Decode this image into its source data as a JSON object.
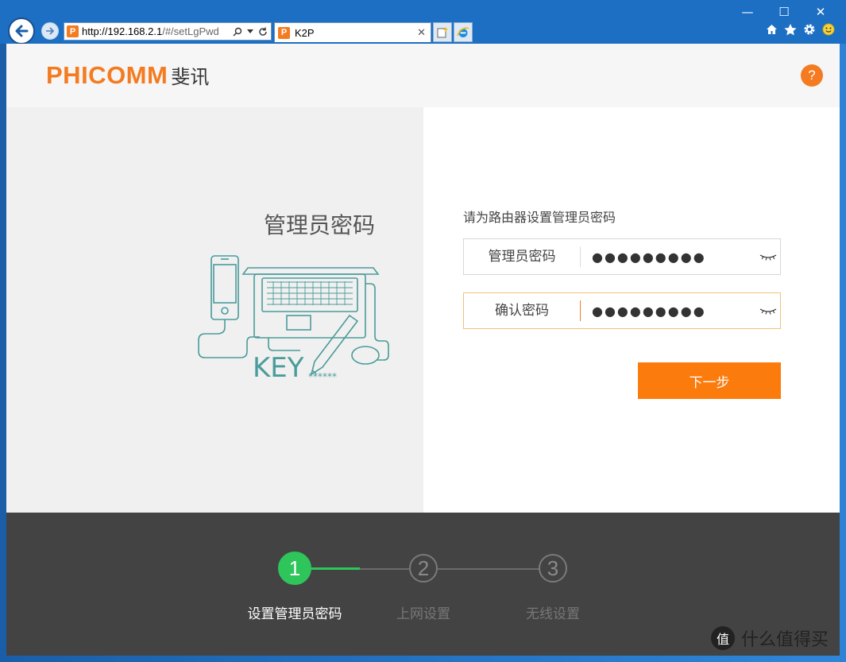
{
  "browser": {
    "address_host": "http://192.168.2.1",
    "address_path": "/#/setLgPwd",
    "site_icon_letter": "P",
    "tab_title": "K2P",
    "tab_close": "✕",
    "win_minimize": "—",
    "win_maximize": "☐",
    "win_close": "✕"
  },
  "header": {
    "logo_en": "PHICOMM",
    "logo_cn": "斐讯",
    "help_label": "?"
  },
  "left": {
    "title": "管理员密码",
    "illus_key_text": "KEY",
    "illus_stars": "******"
  },
  "form": {
    "prompt": "请为路由器设置管理员密码",
    "password_label": "管理员密码",
    "password_value": "●●●●●●●●●",
    "confirm_label": "确认密码",
    "confirm_value": "●●●●●●●●●",
    "next_label": "下一步"
  },
  "steps": [
    {
      "number": "1",
      "label": "设置管理员密码",
      "done": true
    },
    {
      "number": "2",
      "label": "上网设置",
      "done": false
    },
    {
      "number": "3",
      "label": "无线设置",
      "done": false
    }
  ],
  "watermark": {
    "icon_text": "值",
    "text": "什么值得买"
  },
  "colors": {
    "brand_orange": "#f47b20",
    "button_orange": "#fb7c0d",
    "step_done_green": "#2ec55a",
    "footer_bg": "#434343",
    "browser_blue": "#1d6fc4"
  }
}
